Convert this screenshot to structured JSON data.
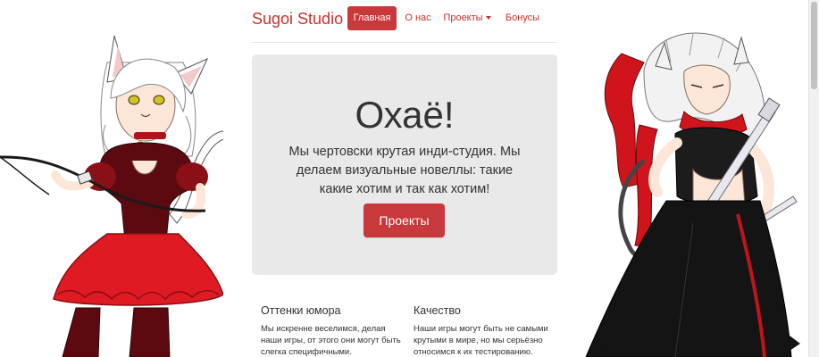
{
  "navbar": {
    "brand": "Sugoi Studio",
    "items": [
      {
        "label": "Главная",
        "active": true
      },
      {
        "label": "О нас",
        "active": false
      },
      {
        "label": "Проекты",
        "active": false,
        "dropdown": true
      },
      {
        "label": "Бонусы",
        "active": false
      }
    ]
  },
  "hero": {
    "title": "Охаё!",
    "lead": "Мы чертовски крутая инди-студия. Мы делаем визуальные новеллы: такие какие хотим и так как хотим!",
    "button_label": "Проекты"
  },
  "features": [
    {
      "title": "Оттенки юмора",
      "text": "Мы искренне веселимся, делая наши игры, от этого они могут быть слегка специфичными."
    },
    {
      "title": "Качество",
      "text": "Наши игры могут быть не самыми крутыми в мире, но мы серьёзно относимся к их тестированию."
    }
  ],
  "artwork": {
    "left": "white-haired catgirl in red-black dress holding whip",
    "right": "white-haired catgirl in black outfit with red scarf holding dagger"
  },
  "colors": {
    "accent": "#c9383a",
    "jumbotron_bg": "#e9e9e9",
    "text": "#333333"
  },
  "icons": {
    "caret": "chevron-down-icon"
  }
}
